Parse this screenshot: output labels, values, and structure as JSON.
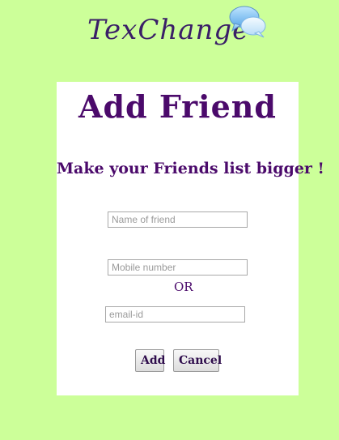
{
  "brand": {
    "name": "TexChange",
    "logo_icon": "chat-bubbles-icon",
    "logo_colors": [
      "#6fb4ea",
      "#d9eefc"
    ]
  },
  "panel": {
    "title": "Add Friend",
    "subtitle": "Make your Friends list bigger !"
  },
  "form": {
    "friend_name": {
      "placeholder": "Name of friend",
      "value": ""
    },
    "mobile": {
      "placeholder": "Mobile number",
      "value": ""
    },
    "separator": "OR",
    "email": {
      "placeholder": "email-id",
      "value": ""
    },
    "add_label": "Add",
    "cancel_label": "Cancel"
  },
  "colors": {
    "page_background": "#ccff99",
    "panel_background": "#ffffff",
    "accent_text": "#4b0a6b"
  }
}
